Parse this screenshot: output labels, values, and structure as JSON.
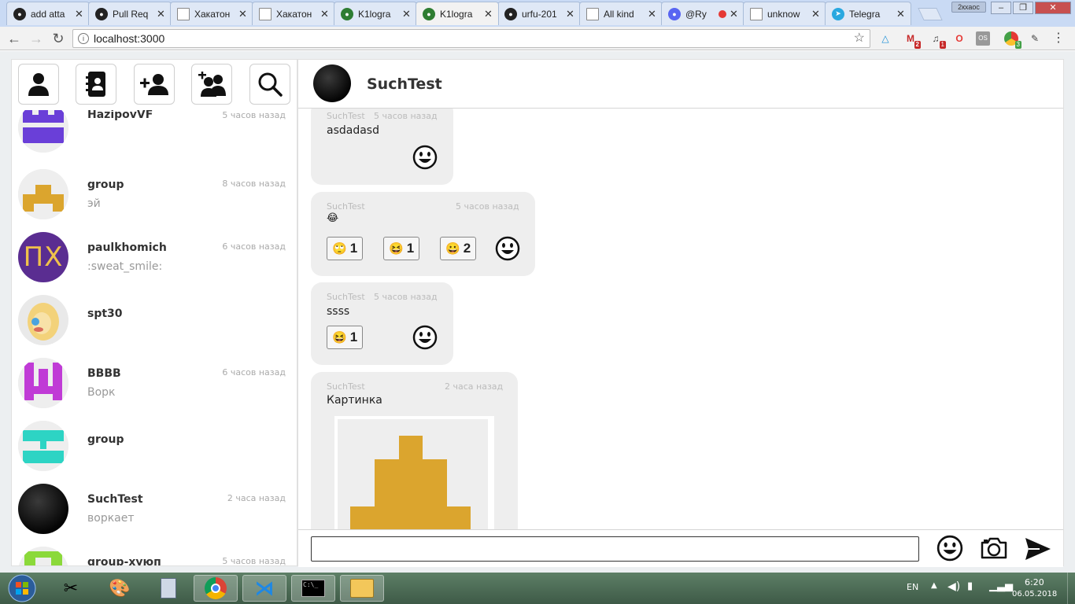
{
  "browser": {
    "tabs": [
      {
        "title": "add atta",
        "icon": "github-icon"
      },
      {
        "title": "Pull Req",
        "icon": "github-icon"
      },
      {
        "title": "Хакатон",
        "icon": "page-icon"
      },
      {
        "title": "Хакатон",
        "icon": "page-icon"
      },
      {
        "title": "K1logra",
        "icon": "app-icon"
      },
      {
        "title": "K1logra",
        "icon": "app-icon",
        "active": true
      },
      {
        "title": "urfu-201",
        "icon": "github-icon"
      },
      {
        "title": "All kind",
        "icon": "page-icon"
      },
      {
        "title": "@Ry",
        "icon": "discord-icon"
      },
      {
        "title": "unknow",
        "icon": "page-icon"
      },
      {
        "title": "Telegra",
        "icon": "telegram-icon"
      }
    ],
    "close_glyph": "✕",
    "profile_label": "2кхаос",
    "url": "localhost:3000",
    "extension_badges": [
      "2",
      "1",
      "3"
    ]
  },
  "app": {
    "chats": [
      {
        "name": "HazipovVF",
        "time": "5 часов назад",
        "preview": "",
        "avatar": "identicon-purple"
      },
      {
        "name": "group",
        "time": "8 часов назад",
        "preview": "эй",
        "avatar": "identicon-gold"
      },
      {
        "name": "paulkhomich",
        "time": "6 часов назад",
        "preview": ":sweat_smile:",
        "avatar": "initials-purple",
        "initials": "ПХ"
      },
      {
        "name": "spt30",
        "time": "",
        "preview": "",
        "avatar": "photo"
      },
      {
        "name": "BBBB",
        "time": "6 часов назад",
        "preview": "Ворк",
        "avatar": "identicon-magenta"
      },
      {
        "name": "group",
        "time": "",
        "preview": "",
        "avatar": "identicon-teal"
      },
      {
        "name": "SuchTest",
        "time": "2 часа назад",
        "preview": "воркает",
        "avatar": "dark-photo"
      },
      {
        "name": "group-хуюп",
        "time": "5 часов назад",
        "preview": "",
        "avatar": "identicon-green"
      }
    ],
    "header": {
      "name": "SuchTest"
    },
    "messages": [
      {
        "author": "SuchTest",
        "time": "5 часов назад",
        "text": "asdadasd",
        "reactions": []
      },
      {
        "author": "SuchTest",
        "time": "5 часов назад",
        "text": "😂",
        "reactions": [
          {
            "emoji": "🙄",
            "count": "1"
          },
          {
            "emoji": "😆",
            "count": "1"
          },
          {
            "emoji": "😀",
            "count": "2"
          }
        ]
      },
      {
        "author": "SuchTest",
        "time": "5 часов назад",
        "text": "ssss",
        "reactions": [
          {
            "emoji": "😆",
            "count": "1"
          }
        ]
      },
      {
        "author": "SuchTest",
        "time": "2 часа назад",
        "text": "Картинка",
        "reactions": []
      }
    ],
    "input": {
      "value": "",
      "placeholder": ""
    }
  },
  "taskbar": {
    "lang": "EN",
    "time": "6:20",
    "date": "06.05.2018"
  },
  "colors": {
    "accent_purple": "#6a3fd8",
    "gold": "#dba52e",
    "teal": "#2dd4c4",
    "magenta": "#c03bd6",
    "lime": "#8bd93a"
  }
}
